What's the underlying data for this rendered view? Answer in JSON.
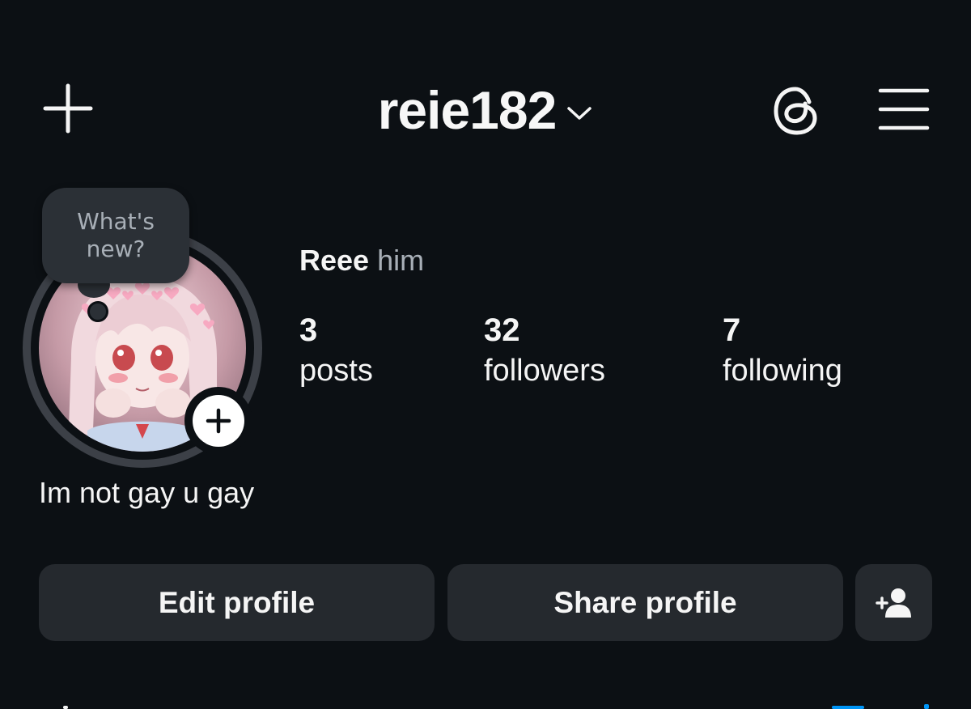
{
  "header": {
    "username": "reie182",
    "create_icon": "plus-icon",
    "switch_account_icon": "chevron-down-icon",
    "threads_icon": "threads-icon",
    "menu_icon": "hamburger-menu-icon"
  },
  "profile": {
    "display_name": "Reee",
    "pronouns": "him",
    "note_bubble": {
      "line1": "What's",
      "line2": "new?"
    },
    "avatar_icon": "profile-avatar",
    "add_story_icon": "plus-icon",
    "bio": "Im not gay u gay"
  },
  "stats": {
    "posts": {
      "value": "3",
      "label": "posts"
    },
    "followers": {
      "value": "32",
      "label": "followers"
    },
    "following": {
      "value": "7",
      "label": "following"
    }
  },
  "actions": {
    "edit_profile": "Edit profile",
    "share_profile": "Share profile",
    "discover_people_icon": "add-person-icon"
  },
  "colors": {
    "background": "#0c1014",
    "button_bg": "#25292e",
    "secondary_text": "#a8afb7",
    "primary_text": "#f5f5f5",
    "accent_blue": "#0095f6"
  }
}
